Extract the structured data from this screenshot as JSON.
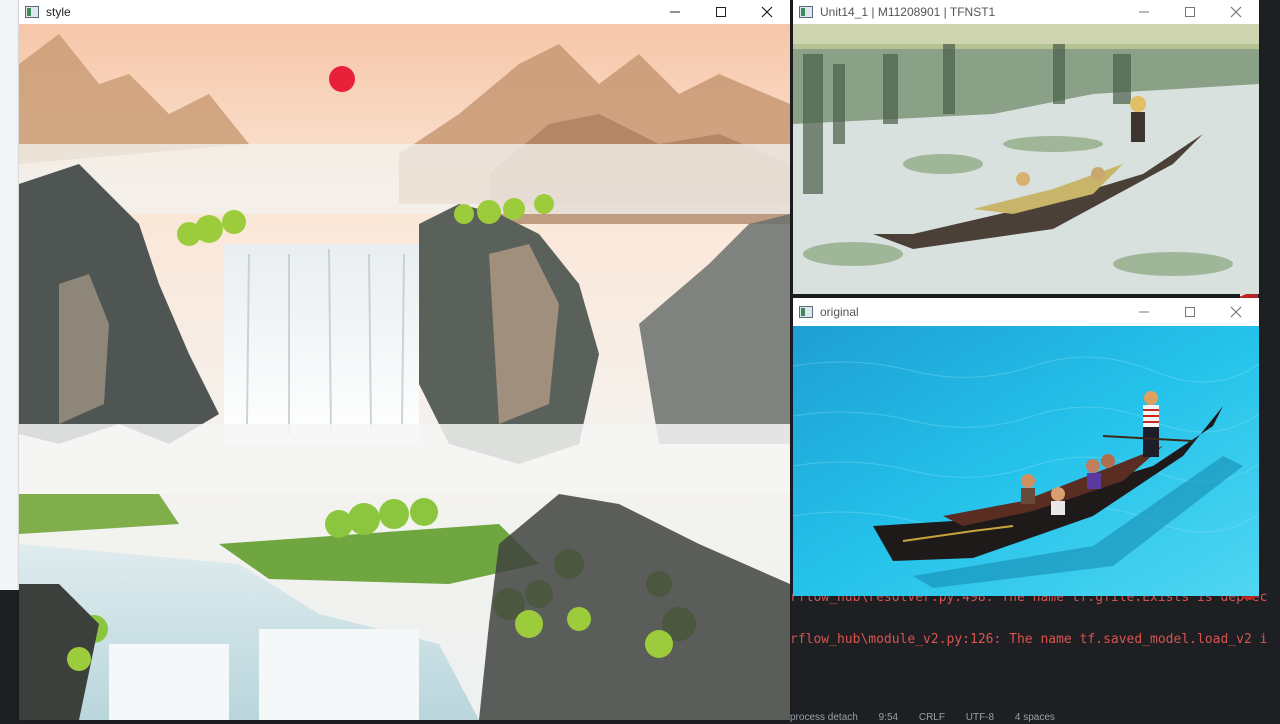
{
  "windows": {
    "style": {
      "title": "style"
    },
    "styled": {
      "title": "Unit14_1 | M11208901 | TFNST1"
    },
    "original": {
      "title": "original"
    }
  },
  "terminal": {
    "line1": "rflow_hub\\resolver.py:498: The name tf.gfile.Exists is deprec",
    "line2": "rflow_hub\\module_v2.py:126: The name tf.saved_model.load_v2 i"
  },
  "statusbar": {
    "left": "process detach",
    "position": "9:54",
    "line_ending": "CRLF",
    "encoding": "UTF-8",
    "indent": "4 spaces"
  },
  "colors": {
    "sun": "#e8203a",
    "water": "#1fb7e6",
    "terminal_text": "#d9534f"
  },
  "icons": {
    "app": "opencv-window-icon",
    "minimize": "minimize-icon",
    "maximize": "maximize-icon",
    "close": "close-icon"
  }
}
